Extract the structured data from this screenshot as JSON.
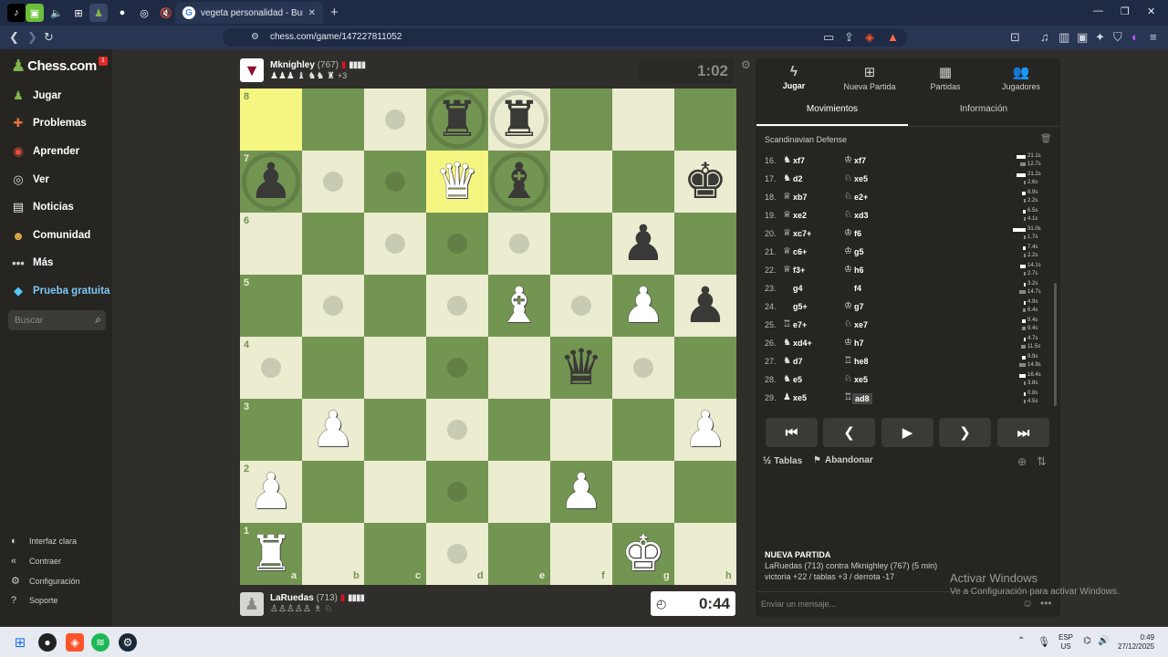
{
  "browser": {
    "tab_title": "vegeta personalidad - Buscar con Go",
    "url": "chess.com/game/147227811052",
    "tab_icon": "google-icon"
  },
  "sidebar": {
    "logo": "Chess.com",
    "notification_count": "1",
    "items": [
      {
        "label": "Jugar",
        "icon": "pawn-play-icon"
      },
      {
        "label": "Problemas",
        "icon": "puzzle-icon"
      },
      {
        "label": "Aprender",
        "icon": "learn-icon"
      },
      {
        "label": "Ver",
        "icon": "binoculars-icon"
      },
      {
        "label": "Noticias",
        "icon": "news-icon"
      },
      {
        "label": "Comunidad",
        "icon": "community-icon"
      },
      {
        "label": "Más",
        "icon": "more-icon"
      },
      {
        "label": "Prueba gratuita",
        "icon": "diamond-icon"
      }
    ],
    "search_placeholder": "Buscar",
    "footer": [
      {
        "label": "Interfaz clara",
        "icon": "theme-icon"
      },
      {
        "label": "Contraer",
        "icon": "collapse-icon"
      },
      {
        "label": "Configuración",
        "icon": "gear-icon"
      },
      {
        "label": "Soporte",
        "icon": "help-icon"
      }
    ]
  },
  "top_player": {
    "name": "Mknighley",
    "rating": "(767)",
    "captured_extra": "+3",
    "clock": "1:02"
  },
  "bottom_player": {
    "name": "LaRuedas",
    "rating": "(713)",
    "clock": "0:44"
  },
  "board": {
    "ranks": [
      "8",
      "7",
      "6",
      "5",
      "4",
      "3",
      "2",
      "1"
    ],
    "files": [
      "a",
      "b",
      "c",
      "d",
      "e",
      "f",
      "g",
      "h"
    ],
    "highlight_squares": [
      "a8",
      "d7"
    ],
    "pieces": [
      {
        "sq": "d8",
        "glyph": "♜",
        "color": "black",
        "name": "black-rook"
      },
      {
        "sq": "e8",
        "glyph": "♜",
        "color": "black",
        "name": "black-rook"
      },
      {
        "sq": "a7",
        "glyph": "♟",
        "color": "black",
        "name": "black-pawn"
      },
      {
        "sq": "d7",
        "glyph": "♛",
        "color": "white",
        "name": "white-queen"
      },
      {
        "sq": "e7",
        "glyph": "♝",
        "color": "black",
        "name": "black-bishop"
      },
      {
        "sq": "h7",
        "glyph": "♚",
        "color": "black",
        "name": "black-king"
      },
      {
        "sq": "g6",
        "glyph": "♟",
        "color": "black",
        "name": "black-pawn"
      },
      {
        "sq": "e5",
        "glyph": "♝",
        "color": "white",
        "name": "white-bishop"
      },
      {
        "sq": "g5",
        "glyph": "♟",
        "color": "white",
        "name": "white-pawn"
      },
      {
        "sq": "h5",
        "glyph": "♟",
        "color": "black",
        "name": "black-pawn"
      },
      {
        "sq": "f4",
        "glyph": "♛",
        "color": "black",
        "name": "black-queen"
      },
      {
        "sq": "b3",
        "glyph": "♟",
        "color": "white",
        "name": "white-pawn"
      },
      {
        "sq": "h3",
        "glyph": "♟",
        "color": "white",
        "name": "white-pawn"
      },
      {
        "sq": "a2",
        "glyph": "♟",
        "color": "white",
        "name": "white-pawn"
      },
      {
        "sq": "f2",
        "glyph": "♟",
        "color": "white",
        "name": "white-pawn"
      },
      {
        "sq": "a1",
        "glyph": "♜",
        "color": "white",
        "name": "white-rook"
      },
      {
        "sq": "g1",
        "glyph": "♚",
        "color": "white",
        "name": "white-king"
      }
    ],
    "move_dots": [
      "c8",
      "b7",
      "c7",
      "c6",
      "d6",
      "e6",
      "b5",
      "d5",
      "f5",
      "a4",
      "d4",
      "g4",
      "d3",
      "d2",
      "d1"
    ],
    "capture_rings": [
      "d8",
      "e8",
      "a7",
      "e7"
    ]
  },
  "panel": {
    "tabs": [
      {
        "label": "Jugar",
        "icon": "bolt-icon"
      },
      {
        "label": "Nueva Partida",
        "icon": "plus-icon"
      },
      {
        "label": "Partidas",
        "icon": "board-icon"
      },
      {
        "label": "Jugadores",
        "icon": "players-icon"
      }
    ],
    "subtabs": [
      "Movimientos",
      "Información"
    ],
    "opening": "Scandinavian Defense",
    "moves": [
      {
        "n": "16.",
        "w": "xf7",
        "b": "xf7",
        "tw": "21.1s",
        "tb": "12.7s",
        "fw": 0.68,
        "fb": 0.41
      },
      {
        "n": "17.",
        "w": "d2",
        "b": "xe5",
        "tw": "21.2s",
        "tb": "2.6s",
        "fw": 0.68,
        "fb": 0.08
      },
      {
        "n": "18.",
        "w": "xb7",
        "b": "e2+",
        "tw": "8.9s",
        "tb": "2.2s",
        "fw": 0.29,
        "fb": 0.07
      },
      {
        "n": "19.",
        "w": "xe2",
        "b": "xd3",
        "tw": "6.5s",
        "tb": "4.1s",
        "fw": 0.21,
        "fb": 0.13
      },
      {
        "n": "20.",
        "w": "xc7+",
        "b": "f6",
        "tw": "31.0s",
        "tb": "1.7s",
        "fw": 1.0,
        "fb": 0.05
      },
      {
        "n": "21.",
        "w": "c6+",
        "b": "g5",
        "tw": "7.4s",
        "tb": "2.2s",
        "fw": 0.24,
        "fb": 0.07
      },
      {
        "n": "22.",
        "w": "f3+",
        "b": "h6",
        "tw": "14.1s",
        "tb": "2.7s",
        "fw": 0.45,
        "fb": 0.09
      },
      {
        "n": "23.",
        "w": "g4",
        "b": "f4",
        "tw": "3.2s",
        "tb": "14.7s",
        "fw": 0.1,
        "fb": 0.47
      },
      {
        "n": "24.",
        "w": "g5+",
        "b": "g7",
        "tw": "4.9s",
        "tb": "6.4s",
        "fw": 0.16,
        "fb": 0.21
      },
      {
        "n": "25.",
        "w": "e7+",
        "b": "xe7",
        "tw": "9.4s",
        "tb": "9.4s",
        "fw": 0.3,
        "fb": 0.3
      },
      {
        "n": "26.",
        "w": "xd4+",
        "b": "h7",
        "tw": "4.7s",
        "tb": "11.5s",
        "fw": 0.15,
        "fb": 0.37
      },
      {
        "n": "27.",
        "w": "d7",
        "b": "he8",
        "tw": "9.9s",
        "tb": "14.9s",
        "fw": 0.32,
        "fb": 0.48
      },
      {
        "n": "28.",
        "w": "e5",
        "b": "xe5",
        "tw": "16.4s",
        "tb": "3.8s",
        "fw": 0.53,
        "fb": 0.12
      },
      {
        "n": "29.",
        "w": "xe5",
        "b": "ad8",
        "tw": "0.8s",
        "tb": "4.5s",
        "fw": 0.03,
        "fb": 0.15
      }
    ],
    "draw_label": "Tablas",
    "resign_label": "Abandonar",
    "new_game_title": "NUEVA PARTIDA",
    "new_game_line1": "LaRuedas (713) contra Mknighley (767) (5 min)",
    "new_game_line2": "victoria +22 / tablas +3 / derrota -17",
    "chat_placeholder": "Enviar un mensaje..."
  },
  "watermark": {
    "title": "Activar Windows",
    "sub": "Ve a Configuración para activar Windows."
  },
  "taskbar": {
    "lang1": "ESP",
    "lang2": "US",
    "time": "0:49",
    "date": "27/12/2025"
  }
}
